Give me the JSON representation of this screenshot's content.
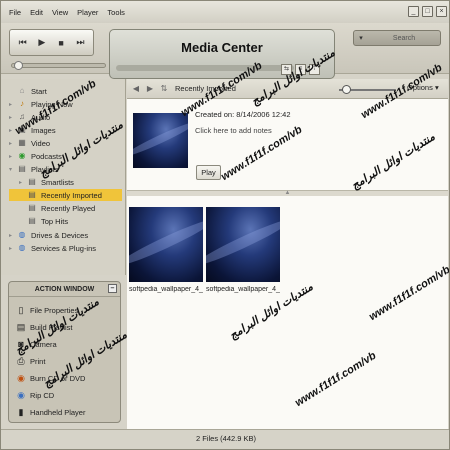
{
  "menu": [
    "File",
    "Edit",
    "View",
    "Player",
    "Tools"
  ],
  "window_buttons": [
    "_",
    "□",
    "×"
  ],
  "player": {
    "title": "Media Center",
    "search_placeholder": "Search",
    "search_dropdown": "▾"
  },
  "sidebar": {
    "items": [
      {
        "label": "Start",
        "icon": "home-icon"
      },
      {
        "label": "Playing Now",
        "icon": "playing-now-icon"
      },
      {
        "label": "Audio",
        "icon": "audio-icon"
      },
      {
        "label": "Images",
        "icon": "images-icon"
      },
      {
        "label": "Video",
        "icon": "video-icon"
      },
      {
        "label": "Podcasts",
        "icon": "podcasts-icon"
      },
      {
        "label": "Playlists",
        "icon": "playlists-icon"
      },
      {
        "label": "Smartlists",
        "icon": "smartlists-icon"
      },
      {
        "label": "Recently Imported",
        "icon": "recently-imported-icon"
      },
      {
        "label": "Recently Played",
        "icon": "recently-played-icon"
      },
      {
        "label": "Top Hits",
        "icon": "top-hits-icon"
      },
      {
        "label": "Drives & Devices",
        "icon": "drives-icon"
      },
      {
        "label": "Services & Plug-ins",
        "icon": "plugins-icon"
      }
    ]
  },
  "action_window": {
    "title": "ACTION WINDOW",
    "items": [
      {
        "label": "File Properties",
        "icon": "file-properties-icon"
      },
      {
        "label": "Build Playlist",
        "icon": "build-playlist-icon"
      },
      {
        "label": "Camera",
        "icon": "camera-icon"
      },
      {
        "label": "Print",
        "icon": "print-icon"
      },
      {
        "label": "Burn CD or DVD",
        "icon": "burn-disc-icon"
      },
      {
        "label": "Rip CD",
        "icon": "rip-cd-icon"
      },
      {
        "label": "Handheld Player",
        "icon": "handheld-player-icon"
      }
    ]
  },
  "pane": {
    "breadcrumb": "Recently Imported",
    "options_label": "Options",
    "created_on": "Created on: 8/14/2006 12:42",
    "add_notes": "Click here to add notes",
    "play_button": "Play"
  },
  "files": [
    {
      "name": "softpedia_wallpaper_4_1..."
    },
    {
      "name": "softpedia_wallpaper_4_1..."
    }
  ],
  "status": "2 Files (442.9 KB)",
  "watermarks": [
    {
      "text": "www.f1f1f.com/vb"
    },
    {
      "text": "منتديات اوائل البرامج"
    },
    {
      "text": "www.f1f1f.com/vb"
    },
    {
      "text": "منتديات اوائل البرامج"
    },
    {
      "text": "www.f1f1f.com/vb"
    },
    {
      "text": "منتديات اوائل البرامج"
    },
    {
      "text": "www.f1f1f.com/vb"
    },
    {
      "text": "منتديات اوائل البرامج"
    },
    {
      "text": "www.f1f1f.com/vb"
    },
    {
      "text": "منتديات اوائل البرامج"
    },
    {
      "text": "www.f1f1f.com/vb"
    },
    {
      "text": "منتديات اوائل البرامج"
    }
  ]
}
